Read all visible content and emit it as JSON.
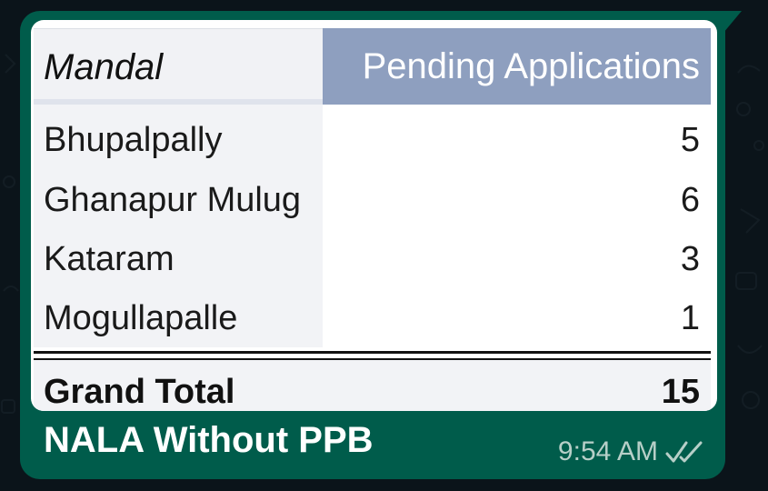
{
  "message": {
    "table": {
      "header": {
        "mandal": "Mandal",
        "value": "Pending Applications"
      },
      "rows": [
        {
          "mandal": "Bhupalpally",
          "value": "5"
        },
        {
          "mandal": "Ghanapur Mulug",
          "value": "6"
        },
        {
          "mandal": "Kataram",
          "value": "3"
        },
        {
          "mandal": "Mogullapalle",
          "value": "1"
        }
      ],
      "total": {
        "label": "Grand Total",
        "value": "15"
      }
    },
    "caption": "NALA Without PPB",
    "time": "9:54 AM",
    "status_icon": "double-check-icon"
  },
  "colors": {
    "background": "#0b141a",
    "bubble": "#005c4b",
    "table_header_value": "#8e9fbf",
    "table_name_column": "#f2f3f6",
    "caption_text": "#ffffff",
    "meta_text": "#b7cfc8"
  }
}
